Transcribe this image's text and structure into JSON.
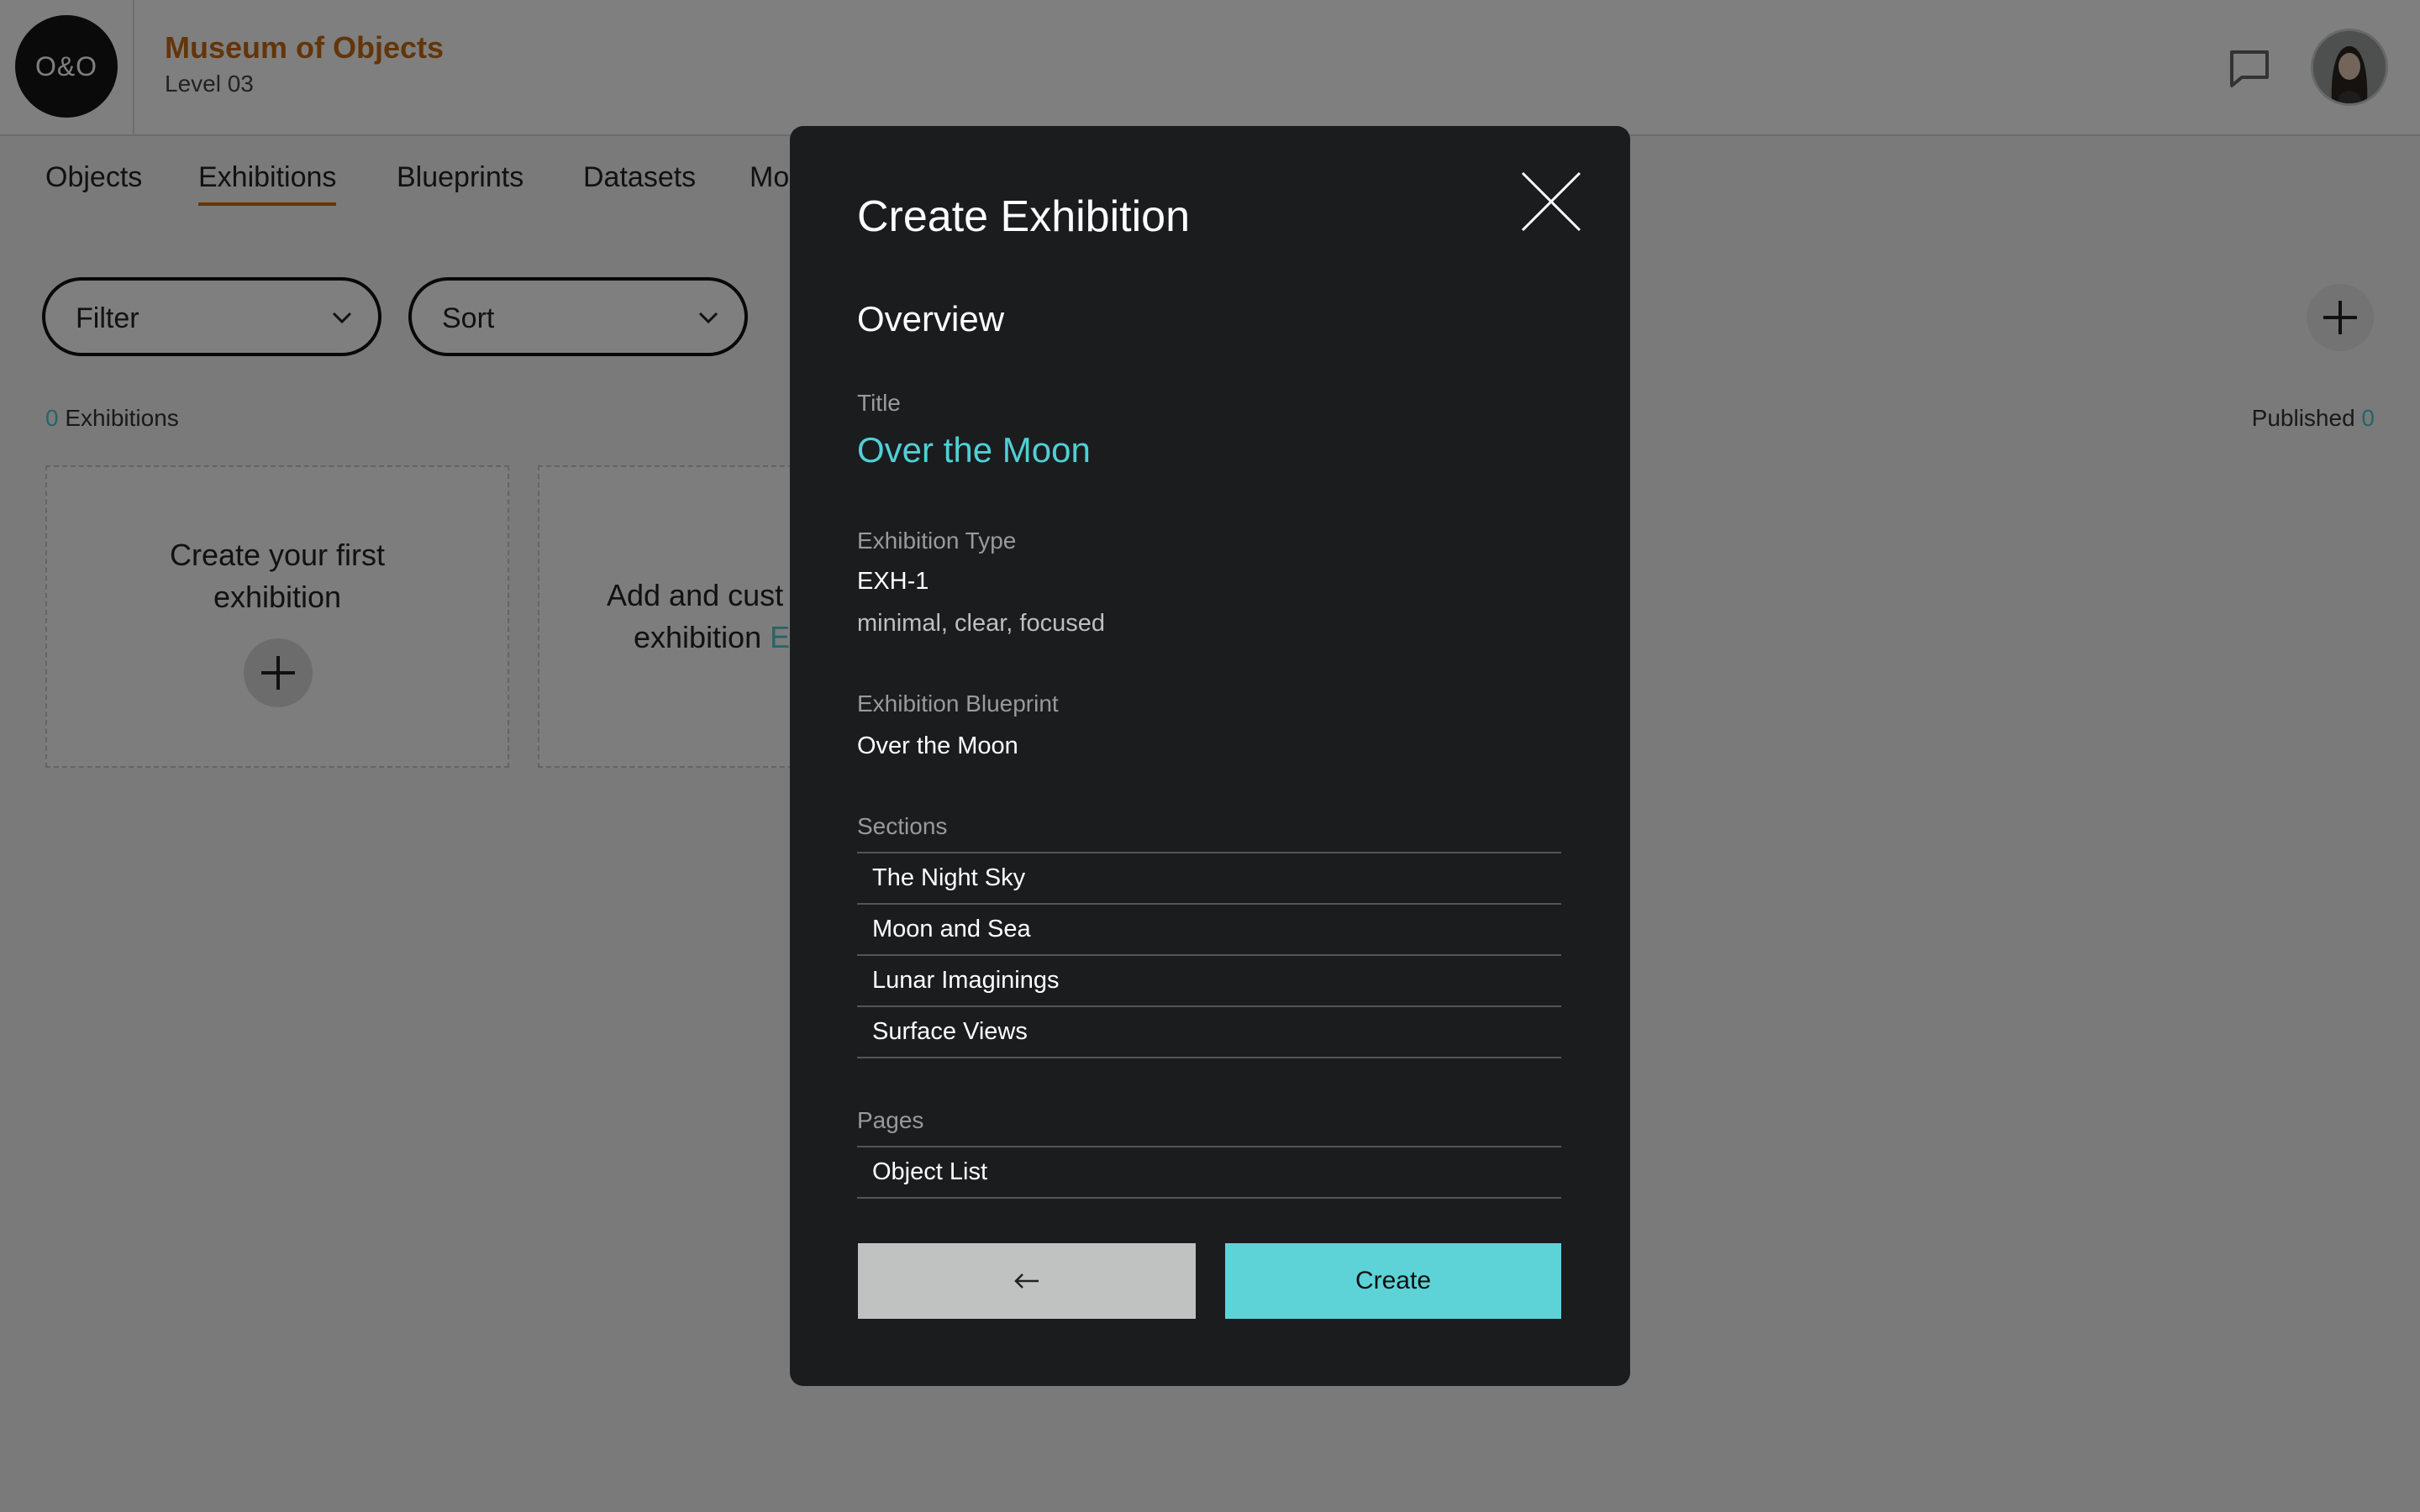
{
  "header": {
    "logo_text": "O&O",
    "museum_name": "Museum of Objects",
    "level": "Level 03"
  },
  "nav": {
    "tabs": [
      {
        "label": "Objects"
      },
      {
        "label": "Exhibitions",
        "active": true
      },
      {
        "label": "Blueprints"
      },
      {
        "label": "Datasets"
      },
      {
        "label": "Mo"
      }
    ]
  },
  "toolbar": {
    "filter_label": "Filter",
    "sort_label": "Sort"
  },
  "summary": {
    "exhibitions_count": "0",
    "exhibitions_label": "Exhibitions",
    "published_label": "Published",
    "published_count": "0"
  },
  "cards": {
    "first_line1": "Create your first",
    "first_line2": "exhibition",
    "second_line1": "Add and cust",
    "second_line2": "exhibition",
    "second_link": "E"
  },
  "modal": {
    "title": "Create Exhibition",
    "section_heading": "Overview",
    "title_label": "Title",
    "title_value": "Over the Moon",
    "type_label": "Exhibition Type",
    "type_value": "EXH-1",
    "type_description": "minimal, clear, focused",
    "blueprint_label": "Exhibition Blueprint",
    "blueprint_value": "Over the Moon",
    "sections_label": "Sections",
    "sections": [
      "The Night Sky",
      "Moon and Sea",
      "Lunar Imaginings",
      "Surface Views"
    ],
    "pages_label": "Pages",
    "pages": [
      "Object List"
    ],
    "create_label": "Create"
  },
  "colors": {
    "accent_orange": "#c76b14",
    "accent_teal": "#5dd3d8",
    "modal_bg": "#1b1c1e",
    "back_button": "#c0c1c1"
  },
  "icons": {
    "close": "close-icon",
    "back": "arrow-left-icon",
    "chat": "chat-icon",
    "add": "plus-icon",
    "dropdown": "chevron-down-icon"
  }
}
